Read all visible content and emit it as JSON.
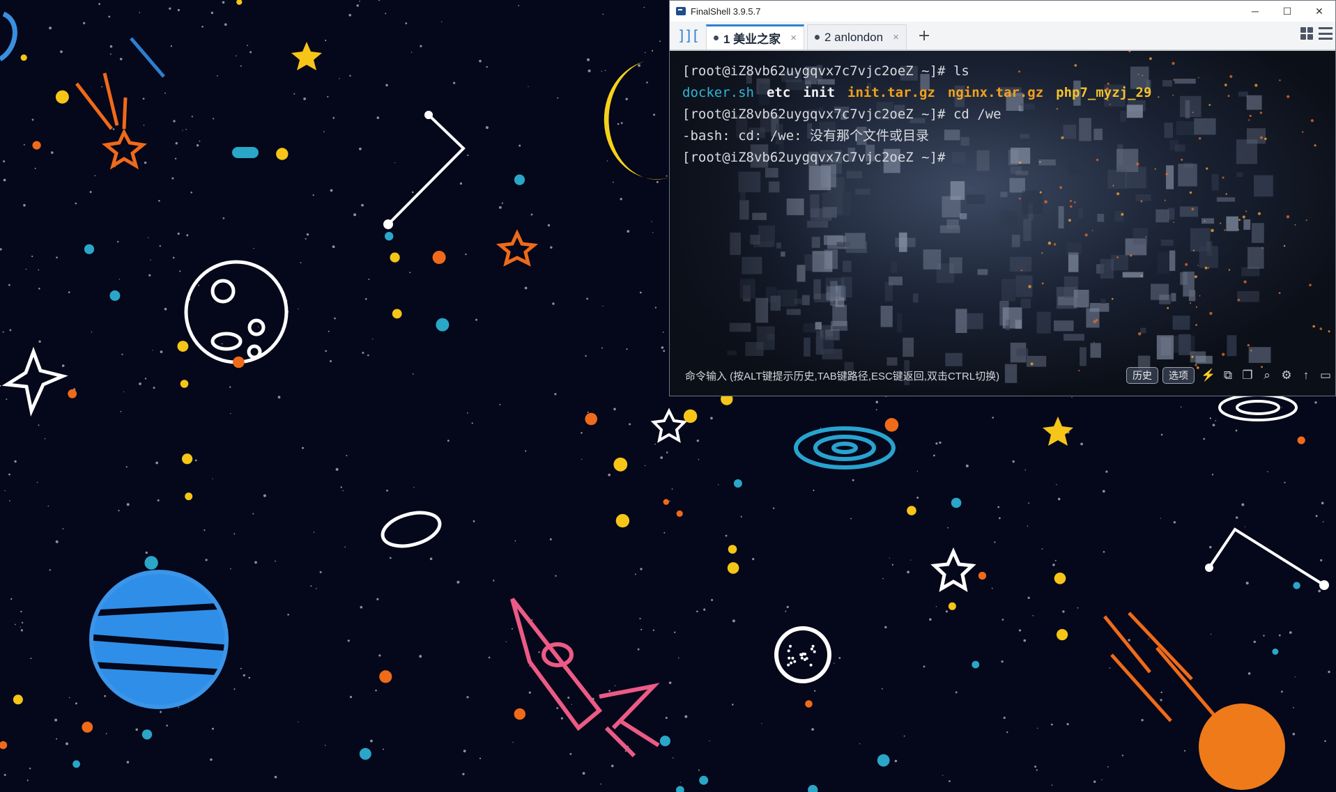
{
  "window": {
    "title": "FinalShell 3.9.5.7",
    "controls": {
      "minimize": "─",
      "maximize": "☐",
      "close": "✕"
    }
  },
  "tabs": [
    {
      "label": "1 美业之家",
      "close": "×",
      "active": true
    },
    {
      "label": "2 anlondon",
      "close": "×",
      "active": false
    }
  ],
  "add_tab_label": "+",
  "panel_toggle_label": "]][",
  "terminal": {
    "prompt": "[root@iZ8vb62uygqvx7c7vjc2oeZ ~]#",
    "lines": [
      {
        "command": " ls"
      },
      {
        "ls_output": [
          "docker.sh",
          "etc",
          "init",
          "init.tar.gz",
          "nginx.tar.gz",
          "php7_myzj_29"
        ]
      },
      {
        "command": " cd /we"
      },
      {
        "error": "-bash: cd: /we: 没有那个文件或目录"
      },
      {
        "command": ""
      }
    ]
  },
  "command_bar": {
    "hint": "命令输入 (按ALT键提示历史,TAB键路径,ESC键返回,双击CTRL切换)",
    "history_button": "历史",
    "options_button": "选项"
  },
  "toolbar_icons": [
    "lightning-icon",
    "copy-icon",
    "paste-icon",
    "search-icon",
    "gear-icon",
    "arrow-up-icon",
    "window-icon"
  ],
  "colors": {
    "tab_accent": "#2d7fd3",
    "ls_cyan": "#2fb5d6",
    "ls_archive": "#f2a11a",
    "ls_script": "#f3c22a"
  }
}
